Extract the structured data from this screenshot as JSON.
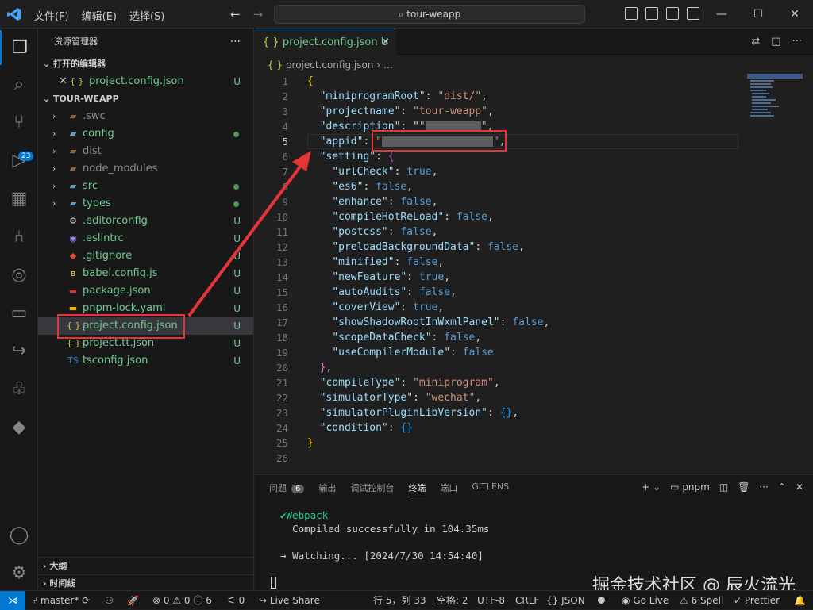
{
  "titlebar": {
    "menus": [
      "文件(F)",
      "编辑(E)",
      "选择(S)"
    ],
    "search": "tour-weapp",
    "dots": "···"
  },
  "activity": {
    "scm_badge": "23"
  },
  "sidebar": {
    "title": "资源管理器",
    "open_editors_label": "打开的编辑器",
    "open_editor_file": "project.config.json",
    "open_editor_status": "U",
    "project_label": "TOUR-WEAPP",
    "items": [
      {
        "name": ".swc",
        "type": "folder",
        "status": ""
      },
      {
        "name": "config",
        "type": "folder",
        "status": "dot"
      },
      {
        "name": "dist",
        "type": "folder",
        "status": ""
      },
      {
        "name": "node_modules",
        "type": "folder",
        "status": ""
      },
      {
        "name": "src",
        "type": "folder",
        "status": "dot"
      },
      {
        "name": "types",
        "type": "folder",
        "status": "dot"
      },
      {
        "name": ".editorconfig",
        "type": "file",
        "status": "U"
      },
      {
        "name": ".eslintrc",
        "type": "file",
        "status": "U"
      },
      {
        "name": ".gitignore",
        "type": "file",
        "status": "U"
      },
      {
        "name": "babel.config.js",
        "type": "file",
        "status": "U"
      },
      {
        "name": "package.json",
        "type": "file",
        "status": "U"
      },
      {
        "name": "pnpm-lock.yaml",
        "type": "file",
        "status": "U"
      },
      {
        "name": "project.config.json",
        "type": "file",
        "status": "U"
      },
      {
        "name": "project.tt.json",
        "type": "file",
        "status": "U"
      },
      {
        "name": "tsconfig.json",
        "type": "file",
        "status": "U"
      }
    ],
    "outline_label": "大纲",
    "timeline_label": "时间线"
  },
  "editor": {
    "tab_label": "project.config.json",
    "tab_status": "U",
    "breadcrumb_file": "project.config.json",
    "breadcrumb_more": "…",
    "lines": [
      "{",
      "  \"miniprogramRoot\": \"dist/\",",
      "  \"projectname\": \"tour-weapp\",",
      "  \"description\": \"",
      "  \"appid\": \"",
      "  \"setting\": {",
      "    \"urlCheck\": true,",
      "    \"es6\": false,",
      "    \"enhance\": false,",
      "    \"compileHotReLoad\": false,",
      "    \"postcss\": false,",
      "    \"preloadBackgroundData\": false,",
      "    \"minified\": false,",
      "    \"newFeature\": true,",
      "    \"autoAudits\": false,",
      "    \"coverView\": true,",
      "    \"showShadowRootInWxmlPanel\": false,",
      "    \"scopeDataCheck\": false,",
      "    \"useCompilerModule\": false",
      "  },",
      "  \"compileType\": \"miniprogram\",",
      "  \"simulatorType\": \"wechat\",",
      "  \"simulatorPluginLibVersion\": {},",
      "  \"condition\": {}",
      "}",
      ""
    ]
  },
  "panel": {
    "tabs": [
      "问题",
      "输出",
      "调试控制台",
      "终端",
      "端口",
      "GITLENS"
    ],
    "problems_count": "6",
    "shell": "pnpm",
    "terminal_line1": "Webpack",
    "terminal_line2": "Compiled successfully in 104.35ms",
    "terminal_line3": "→ Watching... [2024/7/30 14:54:40]"
  },
  "watermark": "掘金技术社区 @ 辰火流光",
  "status": {
    "branch": "master*",
    "errors": "0",
    "warnings": "0",
    "info": "6",
    "ports": "0",
    "liveshare": "Live Share",
    "position": "行 5，列 33",
    "spaces": "空格: 2",
    "encoding": "UTF-8",
    "eol": "CRLF",
    "language": "JSON",
    "golive": "Go Live",
    "spell": "6 Spell",
    "prettier": "Prettier"
  }
}
